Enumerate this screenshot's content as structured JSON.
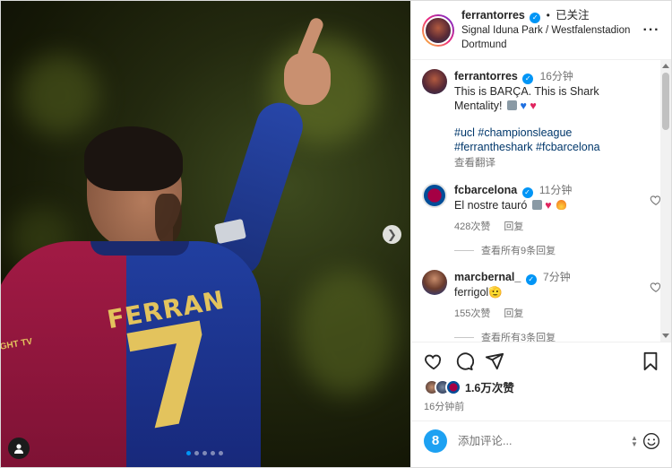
{
  "post": {
    "author": "ferrantorres",
    "follow_separator": "•",
    "follow_state": "已关注",
    "location": "Signal Iduna Park / Westfalenstadion Dortmund",
    "more_icon": "more-horizontal-icon",
    "caption": {
      "username": "ferrantorres",
      "time": "16分钟",
      "text": "This is BARÇA. This is Shark Mentality!",
      "hashtags": "#ucl #championsleague #ferrantheshark #fcbarcelona",
      "translate": "查看翻译"
    },
    "image": {
      "jersey_name": "FERRAN",
      "jersey_number": "7",
      "sponsor": "IGHT TV",
      "carousel_count": 5,
      "carousel_active": 0
    }
  },
  "comments": [
    {
      "username": "fcbarcelona",
      "time": "11分钟",
      "text": "El nostre tauró",
      "likes": "428次赞",
      "reply": "回复",
      "view_replies": "查看所有9条回复"
    },
    {
      "username": "marcbernal_",
      "time": "7分钟",
      "text": "ferrigol🫡",
      "likes": "155次赞",
      "reply": "回复",
      "view_replies": "查看所有3条回复"
    }
  ],
  "footer": {
    "likes": "1.6万次赞",
    "posted": "16分钟前",
    "comment_placeholder": "添加评论...",
    "my_avatar_letter": "8"
  },
  "colors": {
    "link_blue": "#00376b",
    "verified_blue": "#0095f6",
    "muted": "#737373"
  }
}
